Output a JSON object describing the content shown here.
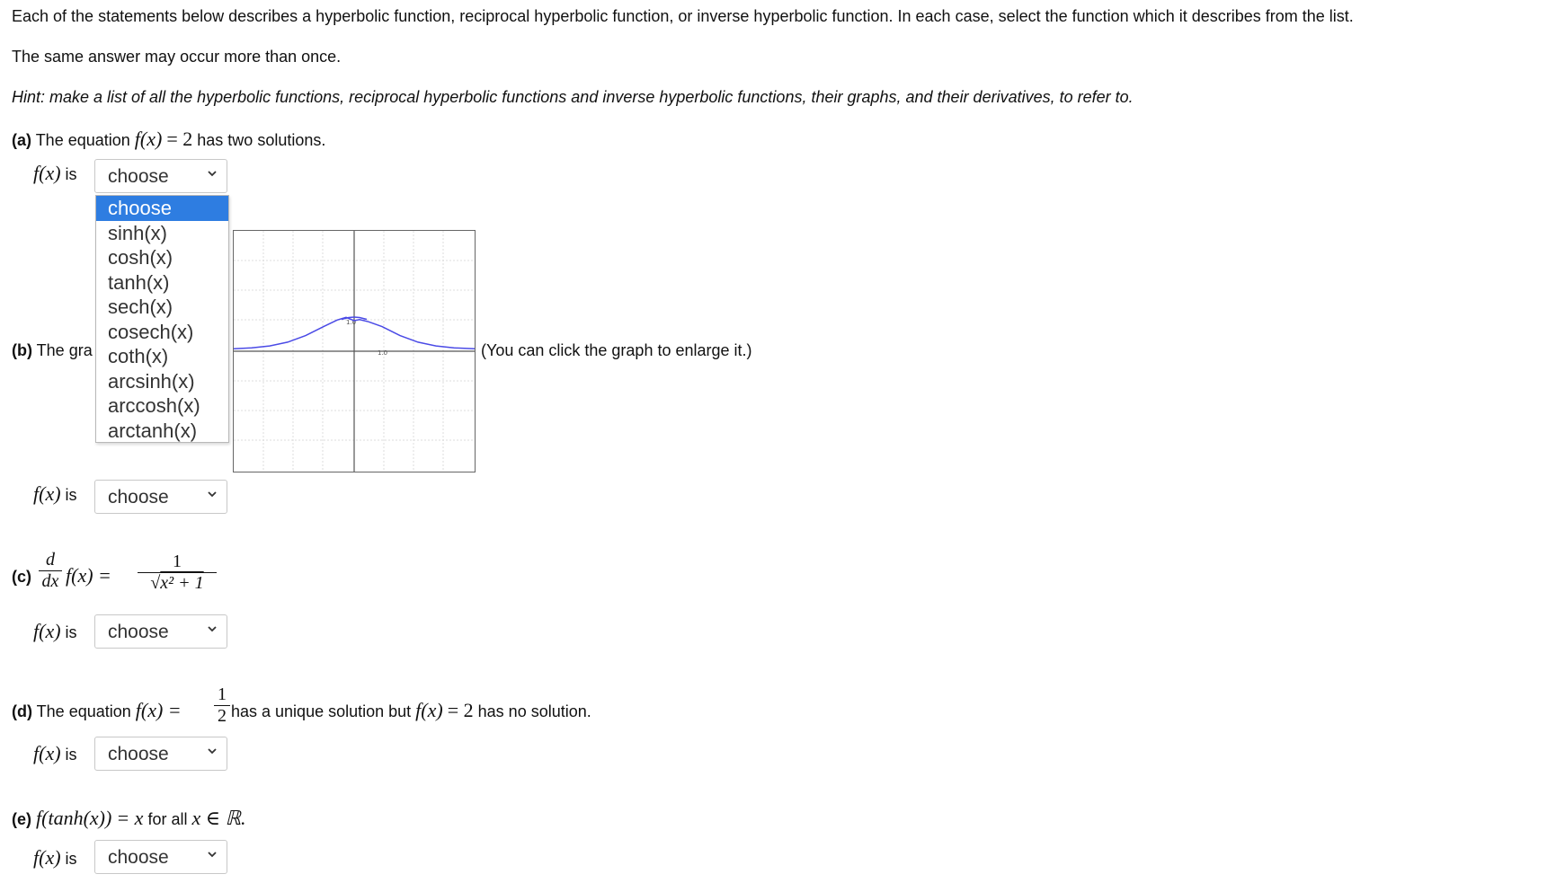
{
  "intro": "Each of the statements below describes a hyperbolic function, reciprocal hyperbolic function, or inverse hyperbolic function. In each case, select the function which it describes from the list.",
  "same_answer": "The same answer may occur more than once.",
  "hint": "Hint: make a list of all the hyperbolic functions, reciprocal hyperbolic functions and inverse hyperbolic functions, their graphs, and their derivatives, to refer to.",
  "fx_is": {
    "fx": "f(x)",
    "is": "is"
  },
  "select_value": "choose",
  "dropdown_options": [
    "choose",
    "sinh(x)",
    "cosh(x)",
    "tanh(x)",
    "sech(x)",
    "cosech(x)",
    "coth(x)",
    "arcsinh(x)",
    "arccosh(x)",
    "arctanh(x)"
  ],
  "part_a": {
    "label": "(a)",
    "text1": "The equation",
    "fx": "f(x)",
    "eq": "= 2",
    "text2": "has two solutions."
  },
  "part_b": {
    "label": "(b)",
    "text": "The gra",
    "graph_note": "(You can click the graph to enlarge it.)"
  },
  "part_c": {
    "label": "(c)",
    "d": "d",
    "dx": "dx",
    "fx": "f(x) =",
    "num": "1",
    "den_sqrt": "x² + 1"
  },
  "part_d": {
    "label": "(d)",
    "text1": "The equation",
    "fx": "f(x) =",
    "num": "1",
    "den": "2",
    "text2": "has a unique solution but",
    "fx2": "f(x)",
    "eq2": "= 2",
    "text3": "has no solution."
  },
  "part_e": {
    "label": "(e)",
    "fx": "f(tanh(x))",
    "eq": "= x",
    "text": "for all",
    "set": "x ∈ ℝ."
  },
  "graph": {
    "tick_y": "1.0",
    "tick_x": "1.0"
  }
}
